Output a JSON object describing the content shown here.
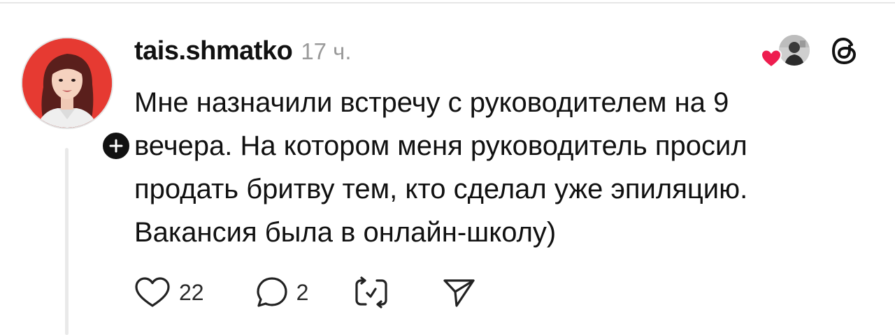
{
  "post": {
    "username": "tais.shmatko",
    "timestamp": "17 ч.",
    "text": "Мне назначили встречу с руководителем на 9\nвечера. На котором меня руководитель просил\nпродать бритву тем, кто сделал уже эпиляцию.\nВакансия была в онлайн-школу)",
    "avatar_bg_color": "#e63a32",
    "follow_badge_icon": "plus-icon"
  },
  "liked_by": {
    "heart_color": "#ee1d4f",
    "heart_icon": "heart-filled-icon"
  },
  "actions": {
    "like_icon": "heart-outline-icon",
    "like_count": "22",
    "comment_icon": "speech-bubble-icon",
    "comment_count": "2",
    "repost_icon": "repost-icon",
    "share_icon": "send-icon"
  },
  "app": {
    "logo_icon": "threads-logo-icon"
  }
}
